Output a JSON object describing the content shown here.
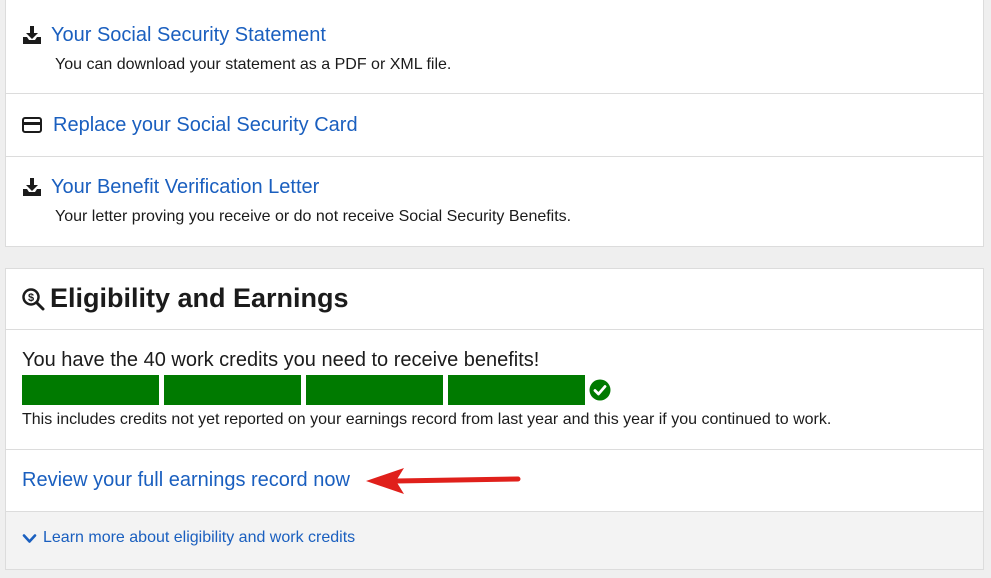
{
  "documents": [
    {
      "icon": "download-icon",
      "title": "Your Social Security Statement",
      "description": "You can download your statement as a PDF or XML file."
    },
    {
      "icon": "credit-card-icon",
      "title": "Replace your Social Security Card",
      "description": ""
    },
    {
      "icon": "download-icon",
      "title": "Your Benefit Verification Letter",
      "description": "Your letter proving you receive or do not receive Social Security Benefits."
    }
  ],
  "eligibility": {
    "icon": "search-dollar-icon",
    "title": "Eligibility and Earnings",
    "credits_message": "You have the 40 work credits you need to receive benefits!",
    "credits_progress": {
      "segments_total": 4,
      "segments_filled": 4,
      "complete": true,
      "color": "#007a00"
    },
    "credits_note": "This includes credits not yet reported on your earnings record from last year and this year if you continued to work.",
    "review_link": "Review your full earnings record now",
    "learn_more": "Learn more about eligibility and work credits"
  },
  "colors": {
    "link": "#1a5fbf",
    "progress": "#007a00",
    "arrow": "#e0201b",
    "check": "#007a00"
  }
}
